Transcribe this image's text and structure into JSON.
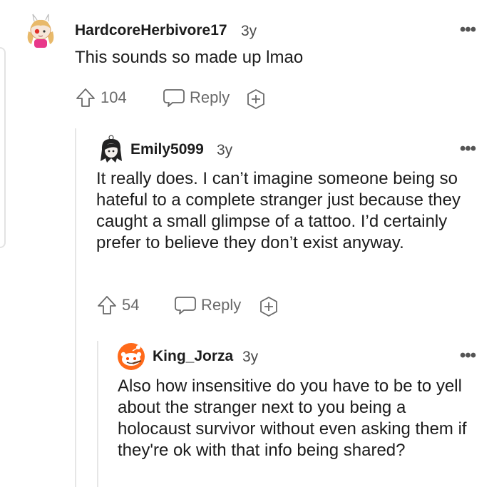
{
  "comments": [
    {
      "username": "HardcoreHerbivore17",
      "age": "3y",
      "text": "This sounds so made up lmao",
      "votes": "104",
      "reply_label": "Reply",
      "avatar_icon": "bunny-girl-avatar-icon"
    },
    {
      "username": "Emily5099",
      "age": "3y",
      "text": "It really does. I can’t imagine someone being so hateful to a complete stranger just because they caught a small glimpse of a tattoo. I’d certainly prefer to believe they don’t exist anyway.",
      "votes": "54",
      "reply_label": "Reply",
      "avatar_icon": "dark-hair-avatar-icon"
    },
    {
      "username": "King_Jorza",
      "age": "3y",
      "text": "Also how insensitive do you have to be to yell about the stranger next to you being a holocaust survivor without even asking them if they're ok with that info being shared?",
      "avatar_icon": "snoo-avatar-icon"
    }
  ],
  "more_glyph": "•••",
  "colors": {
    "text": "#1c1c1c",
    "muted": "#6a6a6a",
    "thread_line": "#e6e6e6",
    "snoo_orange": "#ff6a1a"
  }
}
